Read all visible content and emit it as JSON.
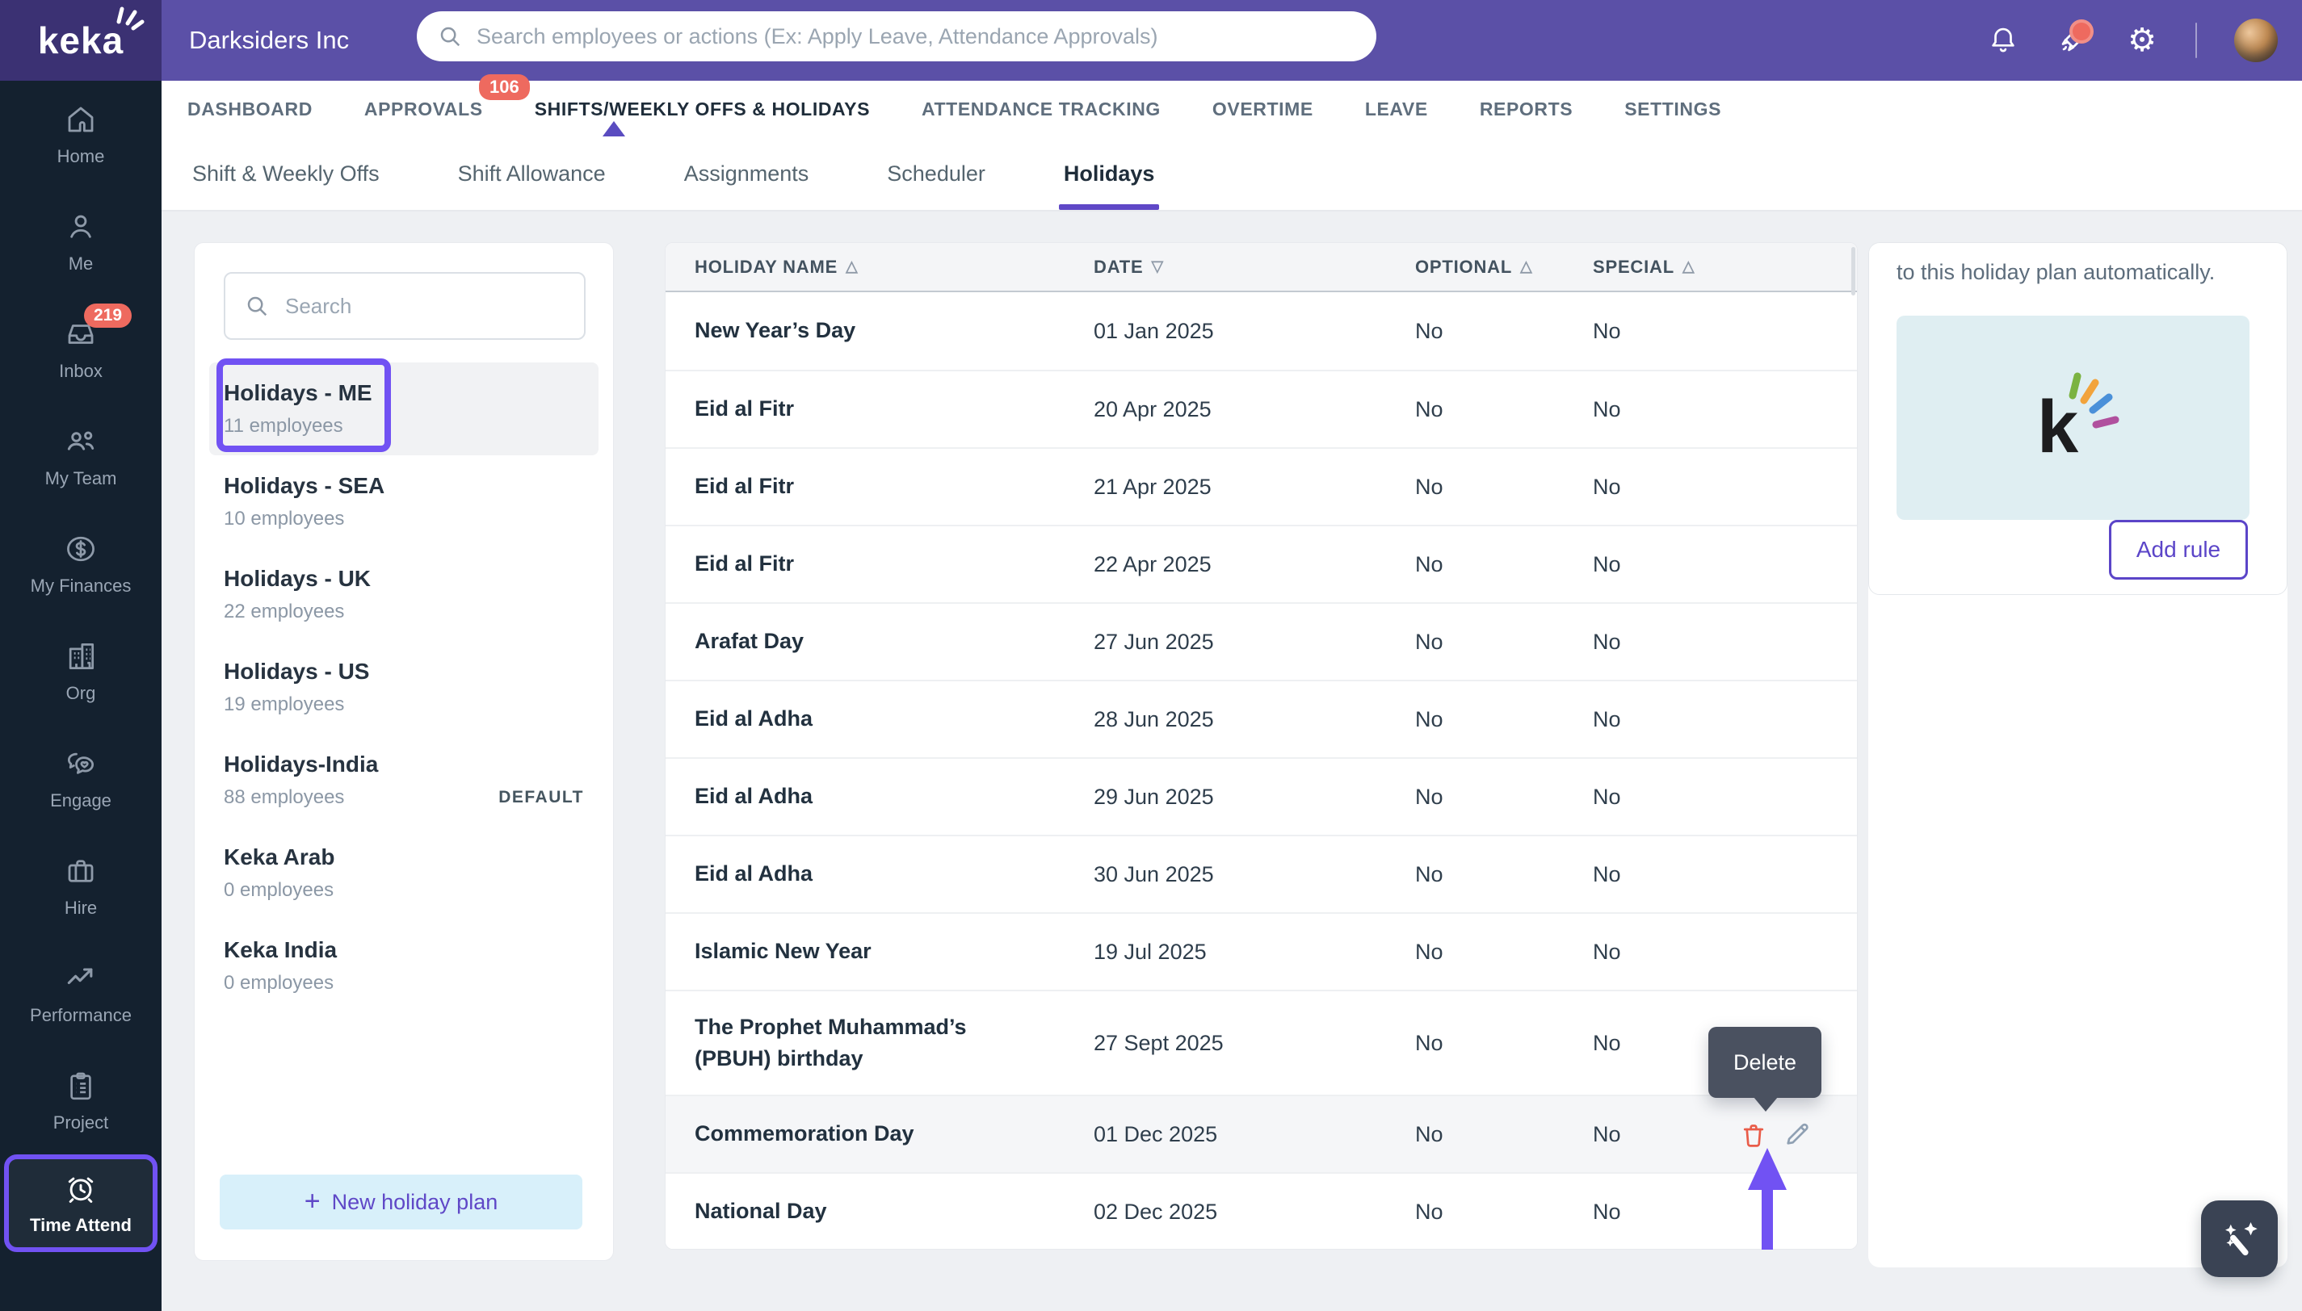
{
  "topbar": {
    "company": "Darksiders Inc",
    "search_placeholder": "Search employees or actions (Ex: Apply Leave, Attendance Approvals)"
  },
  "nav": {
    "tabs": [
      {
        "label": "DASHBOARD"
      },
      {
        "label": "APPROVALS",
        "badge": "106"
      },
      {
        "label": "SHIFTS/WEEKLY OFFS & HOLIDAYS",
        "active": true
      },
      {
        "label": "ATTENDANCE TRACKING"
      },
      {
        "label": "OVERTIME"
      },
      {
        "label": "LEAVE"
      },
      {
        "label": "REPORTS"
      },
      {
        "label": "SETTINGS"
      }
    ]
  },
  "subnav": {
    "tabs": [
      {
        "label": "Shift & Weekly Offs"
      },
      {
        "label": "Shift Allowance"
      },
      {
        "label": "Assignments"
      },
      {
        "label": "Scheduler"
      },
      {
        "label": "Holidays",
        "active": true
      }
    ]
  },
  "sidebar": {
    "items": [
      {
        "label": "Home",
        "icon": "home"
      },
      {
        "label": "Me",
        "icon": "user"
      },
      {
        "label": "Inbox",
        "icon": "inbox",
        "badge": "219"
      },
      {
        "label": "My Team",
        "icon": "team"
      },
      {
        "label": "My Finances",
        "icon": "finance"
      },
      {
        "label": "Org",
        "icon": "org"
      },
      {
        "label": "Engage",
        "icon": "engage"
      },
      {
        "label": "Hire",
        "icon": "hire"
      },
      {
        "label": "Performance",
        "icon": "performance"
      },
      {
        "label": "Project",
        "icon": "project"
      },
      {
        "label": "Time Attend",
        "icon": "clock",
        "active": true
      }
    ]
  },
  "plans": {
    "search_placeholder": "Search",
    "new_button": "New holiday plan",
    "items": [
      {
        "name": "Holidays - ME",
        "sub": "11 employees",
        "selected": true
      },
      {
        "name": "Holidays - SEA",
        "sub": "10 employees"
      },
      {
        "name": "Holidays - UK",
        "sub": "22 employees"
      },
      {
        "name": "Holidays - US",
        "sub": "19 employees"
      },
      {
        "name": "Holidays-India",
        "sub": "88 employees",
        "tag": "DEFAULT"
      },
      {
        "name": "Keka Arab",
        "sub": "0 employees"
      },
      {
        "name": "Keka India",
        "sub": "0 employees"
      }
    ]
  },
  "table": {
    "columns": [
      {
        "label": "HOLIDAY NAME",
        "sort_glyph": "△"
      },
      {
        "label": "DATE",
        "sort_glyph": "▽"
      },
      {
        "label": "OPTIONAL",
        "sort_glyph": "△"
      },
      {
        "label": "SPECIAL",
        "sort_glyph": "△"
      }
    ],
    "rows": [
      {
        "name": "New Year’s Day",
        "date": "01 Jan 2025",
        "optional": "No",
        "special": "No"
      },
      {
        "name": "Eid al Fitr",
        "date": "20 Apr 2025",
        "optional": "No",
        "special": "No"
      },
      {
        "name": "Eid al Fitr",
        "date": "21 Apr 2025",
        "optional": "No",
        "special": "No"
      },
      {
        "name": "Eid al Fitr",
        "date": "22 Apr 2025",
        "optional": "No",
        "special": "No"
      },
      {
        "name": "Arafat Day",
        "date": "27 Jun 2025",
        "optional": "No",
        "special": "No"
      },
      {
        "name": "Eid al Adha",
        "date": "28 Jun 2025",
        "optional": "No",
        "special": "No"
      },
      {
        "name": "Eid al Adha",
        "date": "29 Jun 2025",
        "optional": "No",
        "special": "No"
      },
      {
        "name": "Eid al Adha",
        "date": "30 Jun 2025",
        "optional": "No",
        "special": "No"
      },
      {
        "name": "Islamic New Year",
        "date": "19 Jul 2025",
        "optional": "No",
        "special": "No"
      },
      {
        "name": "The Prophet Muhammad’s (PBUH) birthday",
        "date": "27 Sept 2025",
        "optional": "No",
        "special": "No",
        "tall": true
      },
      {
        "name": "Commemoration Day",
        "date": "01 Dec 2025",
        "optional": "No",
        "special": "No",
        "hovered": true
      },
      {
        "name": "National Day",
        "date": "02 Dec 2025",
        "optional": "No",
        "special": "No"
      }
    ]
  },
  "right_panel": {
    "text": "to this holiday plan automatically.",
    "button": "Add rule"
  },
  "tooltip": {
    "label": "Delete"
  },
  "colors": {
    "header_purple": "#5b50a7",
    "logo_purple": "#3b3173",
    "sidebar_navy": "#14212f",
    "accent_purple": "#5f48c7",
    "annotation_purple": "#7152f3",
    "badge_red": "#ee6a5f",
    "delete_red": "#e95c49",
    "teal_box": "#dfeef2"
  }
}
